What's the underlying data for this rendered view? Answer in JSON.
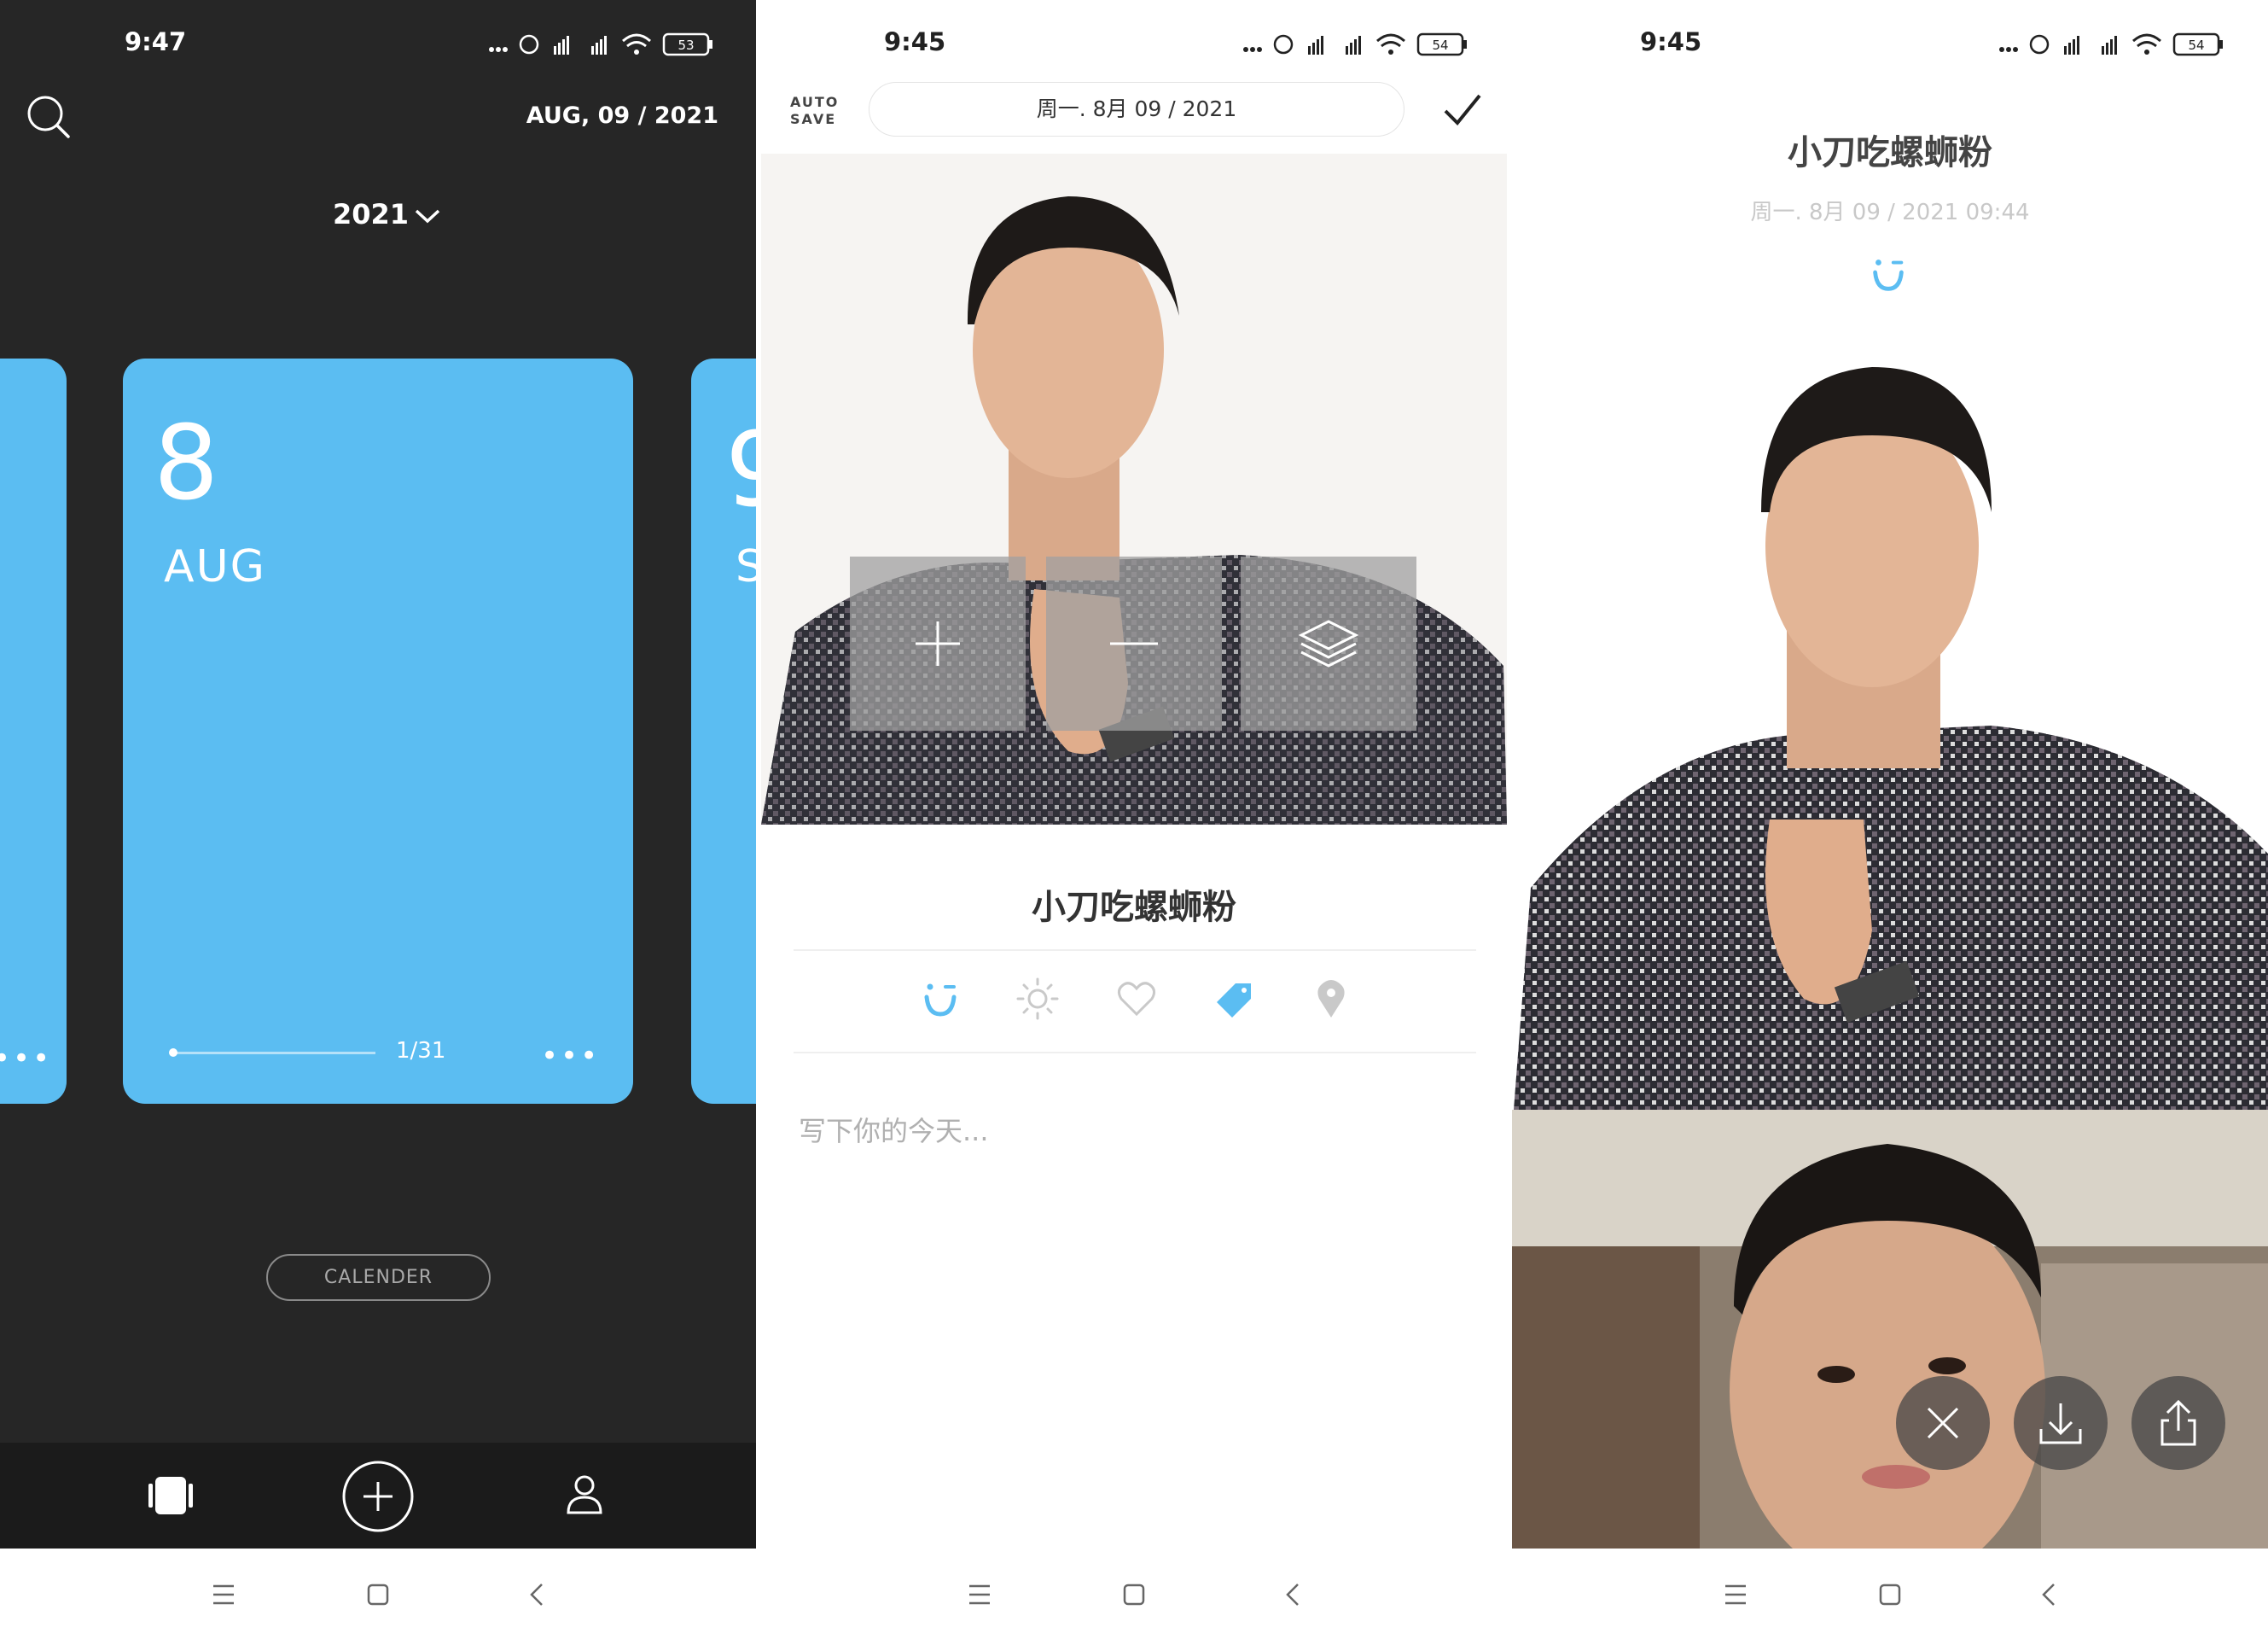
{
  "screen1": {
    "status": {
      "time": "9:47",
      "battery": "53"
    },
    "header_date": "AUG, 09 / 2021",
    "year_selector": "2021",
    "card": {
      "day": "8",
      "month": "AUG",
      "progress_label": "1/31",
      "progress_fraction": 0.03
    },
    "next_card": {
      "day": "9",
      "month": "S"
    },
    "calendar_button": "CALENDER"
  },
  "screen2": {
    "status": {
      "time": "9:45",
      "battery": "54"
    },
    "autosave_line1": "AUTO",
    "autosave_line2": "SAVE",
    "date": "周一. 8月 09 / 2021",
    "title": "小刀吃螺蛳粉",
    "placeholder": "写下你的今天...",
    "colors": {
      "accent": "#5bbdf2",
      "icon_gray": "#c9c9c9"
    },
    "photo_page_index": 0
  },
  "screen3": {
    "status": {
      "time": "9:45",
      "battery": "54"
    },
    "title": "小刀吃螺蛳粉",
    "subtitle": "周一. 8月 09 / 2021 09:44"
  },
  "colors": {
    "card_blue": "#5bbdf2",
    "dark_bg": "#262626"
  }
}
